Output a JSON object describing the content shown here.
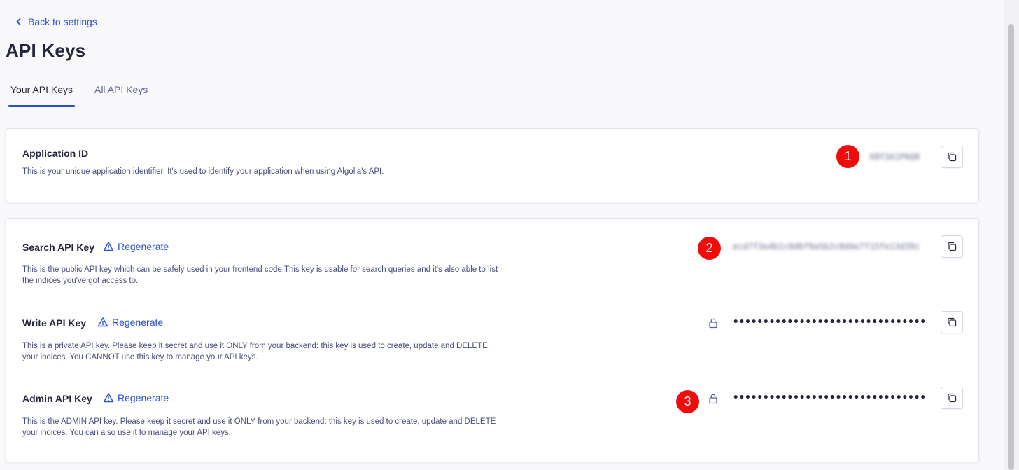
{
  "nav": {
    "back_label": "Back to settings"
  },
  "page": {
    "title": "API Keys"
  },
  "tabs": [
    {
      "label": "Your API Keys",
      "active": true
    },
    {
      "label": "All API Keys",
      "active": false
    }
  ],
  "application_id": {
    "title": "Application ID",
    "description": "This is your unique application identifier. It's used to identify your application when using Algolia's API.",
    "value": "X8Y3A1P6Q8",
    "badge": "1"
  },
  "search_key": {
    "title": "Search API Key",
    "regenerate_label": "Regenerate",
    "description": "This is the public API key which can be safely used in your frontend code.This key is usable for search queries and it's also able to list the indices you've got access to.",
    "value": "ecd7f3e4b1c0d6f9a5b2c8d4e7f15fe13d39c",
    "badge": "2"
  },
  "write_key": {
    "title": "Write API Key",
    "regenerate_label": "Regenerate",
    "description": "This is a private API key. Please keep it secret and use it ONLY from your backend: this key is used to create, update and DELETE your indices. You CANNOT use this key to manage your API keys.",
    "masked": "••••••••••••••••••••••••••••••••"
  },
  "admin_key": {
    "title": "Admin API Key",
    "regenerate_label": "Regenerate",
    "description": "This is the ADMIN API key. Please keep it secret and use it ONLY from your backend: this key is used to create, update and DELETE your indices. You can also use it to manage your API keys.",
    "masked": "••••••••••••••••••••••••••••••••",
    "badge": "3"
  },
  "icons": {
    "back": "chevron-left-icon",
    "warning": "warning-triangle-icon",
    "copy": "copy-icon",
    "lock": "lock-icon"
  },
  "colors": {
    "accent": "#2850d0",
    "text": "#23263b",
    "badge": "#f10b0b"
  }
}
